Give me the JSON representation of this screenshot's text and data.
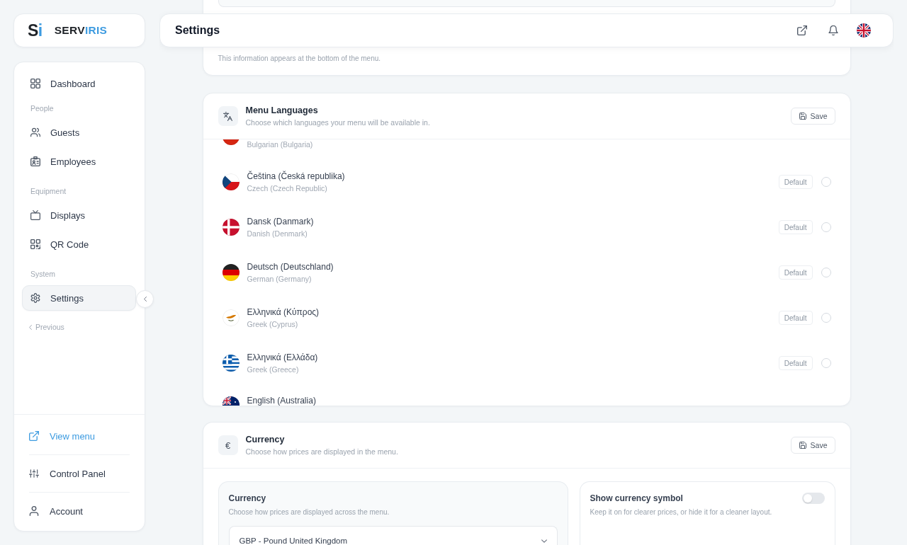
{
  "brand": {
    "monogram": [
      {
        "text": "S",
        "color": "#1f2328"
      },
      {
        "text": "i",
        "color": "#3d9be0"
      }
    ],
    "name": [
      {
        "text": "SERV",
        "color": "#1f2328"
      },
      {
        "text": "IRIS",
        "color": "#3d9be0"
      }
    ]
  },
  "sidebar": {
    "sections": [
      {
        "items": [
          {
            "label": "Dashboard",
            "selected": false
          }
        ]
      },
      {
        "heading": "People",
        "items": [
          {
            "label": "Guests",
            "selected": false
          },
          {
            "label": "Employees",
            "selected": false
          }
        ]
      },
      {
        "heading": "Equipment",
        "items": [
          {
            "label": "Displays",
            "selected": false
          },
          {
            "label": "QR Code",
            "selected": false
          }
        ]
      },
      {
        "heading": "System",
        "items": [
          {
            "label": "Settings",
            "selected": true
          }
        ]
      }
    ],
    "previous": "Previous",
    "footer": [
      {
        "label": "View menu",
        "kind": "link"
      },
      {
        "label": "Control Panel",
        "kind": "item"
      },
      {
        "label": "Account",
        "kind": "item"
      }
    ]
  },
  "header": {
    "title": "Settings"
  },
  "menu_info": {
    "note": "This information appears at the bottom of the menu."
  },
  "languages": {
    "title": "Menu Languages",
    "subtitle": "Choose which languages your menu will be available in.",
    "save": "Save",
    "rows": [
      {
        "kind": "tail",
        "english": "Bulgarian (Bulgaria)"
      },
      {
        "kind": "whole",
        "name": "Čeština (Česká republika)",
        "english": "Czech (Czech Republic)",
        "default": "Default",
        "selected": false
      },
      {
        "kind": "whole",
        "name": "Dansk (Danmark)",
        "english": "Danish (Denmark)",
        "default": "Default",
        "selected": false
      },
      {
        "kind": "whole",
        "name": "Deutsch (Deutschland)",
        "english": "German (Germany)",
        "default": "Default",
        "selected": false
      },
      {
        "kind": "whole",
        "name": "Ελληνικά (Κύπρος)",
        "english": "Greek (Cyprus)",
        "default": "Default",
        "selected": false
      },
      {
        "kind": "whole",
        "name": "Ελληνικά (Ελλάδα)",
        "english": "Greek (Greece)",
        "default": "Default",
        "selected": false
      },
      {
        "kind": "head",
        "name": "English (Australia)"
      }
    ]
  },
  "currency": {
    "symbol": "€",
    "title": "Currency",
    "subtitle": "Choose how prices are displayed in the menu.",
    "save": "Save",
    "select": {
      "label": "Currency",
      "description": "Choose how prices are displayed across the menu.",
      "value": "GBP - Pound United Kingdom"
    },
    "symbol_toggle": {
      "label": "Show currency symbol",
      "description": "Keep it on for clearer prices, or hide it for a cleaner layout.",
      "on": false
    }
  }
}
